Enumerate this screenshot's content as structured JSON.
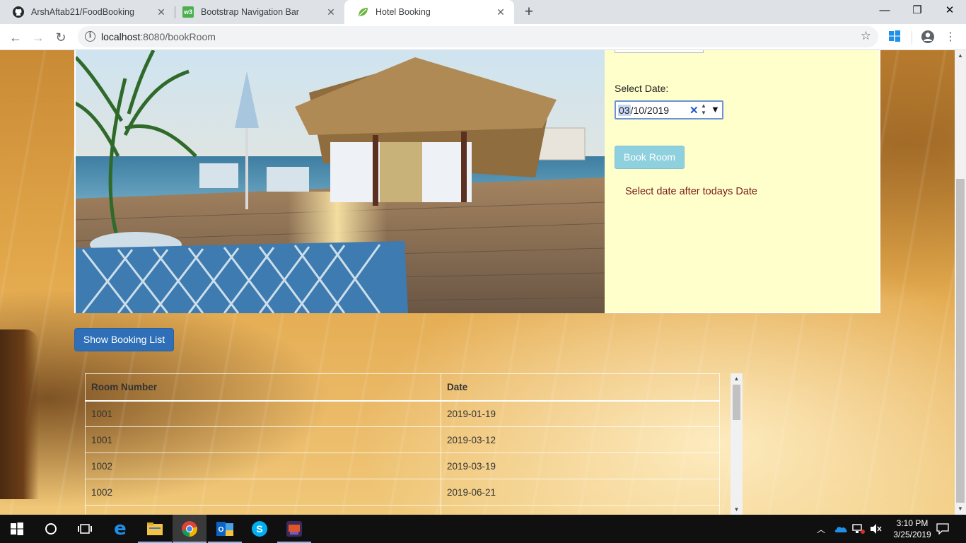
{
  "browser": {
    "tabs": [
      {
        "title": "ArshAftab21/FoodBooking",
        "active": false,
        "icon": "github-icon"
      },
      {
        "title": "Bootstrap Navigation Bar",
        "active": false,
        "icon": "w3schools-icon"
      },
      {
        "title": "Hotel Booking",
        "active": true,
        "icon": "spring-leaf-icon"
      }
    ],
    "url_host": "localhost",
    "url_rest": ":8080/bookRoom"
  },
  "form": {
    "date_label": "Select Date:",
    "date_month": "03",
    "date_rest": "/10/2019",
    "book_button": "Book Room",
    "message": "Select date after todays Date"
  },
  "show_button": "Show Booking List",
  "bookings": {
    "headers": [
      "Room Number",
      "Date"
    ],
    "rows": [
      [
        "1001",
        "2019-01-19"
      ],
      [
        "1001",
        "2019-03-12"
      ],
      [
        "1002",
        "2019-03-19"
      ],
      [
        "1002",
        "2019-06-21"
      ],
      [
        "",
        ""
      ]
    ]
  },
  "taskbar": {
    "time": "3:10 PM",
    "date": "3/25/2019"
  },
  "colors": {
    "panel_bg": "#ffffcc",
    "book_button": "#8ed0de",
    "show_button": "#2e6fb7",
    "message": "#7a1a1a"
  }
}
